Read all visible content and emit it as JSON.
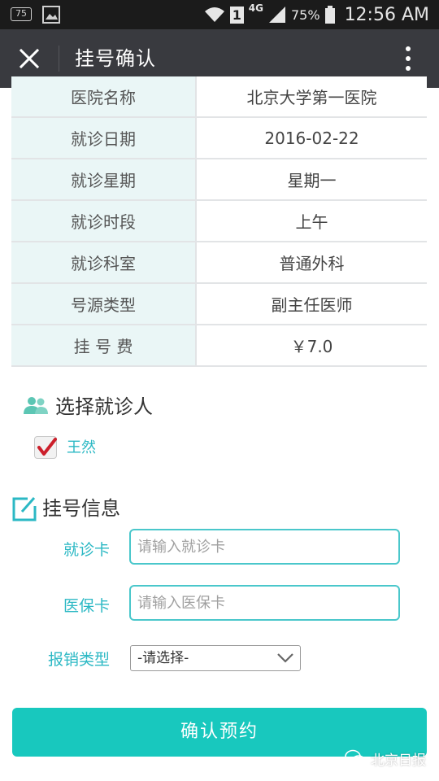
{
  "status_bar": {
    "notification_badge": "75",
    "network": "4G",
    "battery_percent": "75%",
    "time": "12:56 AM",
    "sim_label": "1"
  },
  "app_bar": {
    "title": "挂号确认"
  },
  "info_table": [
    {
      "label": "医院名称",
      "value": "北京大学第一医院"
    },
    {
      "label": "就诊日期",
      "value": "2016-02-22"
    },
    {
      "label": "就诊星期",
      "value": "星期一"
    },
    {
      "label": "就诊时段",
      "value": "上午"
    },
    {
      "label": "就诊科室",
      "value": "普通外科"
    },
    {
      "label": "号源类型",
      "value": "副主任医师"
    },
    {
      "label": "挂 号 费",
      "value": "￥7.0"
    }
  ],
  "patient_section": {
    "title": "选择就诊人",
    "patient_name": "王然",
    "selected": true
  },
  "registration_section": {
    "title": "挂号信息",
    "card_label": "就诊卡",
    "card_placeholder": "请输入就诊卡",
    "card_value": "",
    "insurance_label": "医保卡",
    "insurance_placeholder": "请输入医保卡",
    "insurance_value": "",
    "reimbursement_label": "报销类型",
    "reimbursement_selected": "-请选择-"
  },
  "confirm_button": "确认预约",
  "watermark": "北京日报",
  "colors": {
    "accent": "#18c8be",
    "label_teal": "#2bb8c4",
    "app_bar": "#393a3f",
    "check_red": "#cc1f2b"
  }
}
